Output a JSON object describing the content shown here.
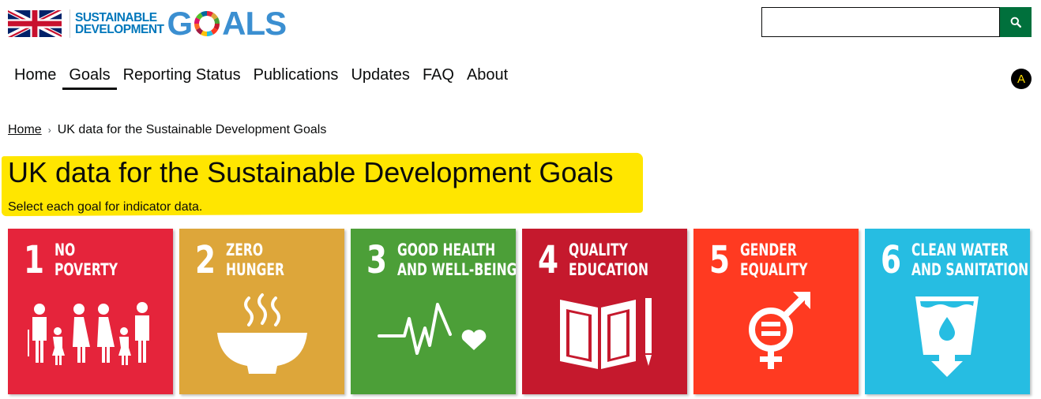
{
  "header": {
    "logo_line1": "SUSTAINABLE",
    "logo_line2": "DEVELOPMENT",
    "logo_big_pre": "G",
    "logo_big_post": "ALS",
    "search_placeholder": ""
  },
  "nav": {
    "items": [
      "Home",
      "Goals",
      "Reporting Status",
      "Publications",
      "Updates",
      "FAQ",
      "About"
    ],
    "active": "Goals",
    "accessibility_label": "A"
  },
  "breadcrumb": {
    "home": "Home",
    "separator": "›",
    "current": "UK data for the Sustainable Development Goals"
  },
  "page": {
    "title": "UK data for the Sustainable Development Goals",
    "subtitle": "Select each goal for indicator data."
  },
  "goals": [
    {
      "number": "1",
      "label": "NO\nPOVERTY",
      "color": "#e5243b",
      "icon": "family-icon"
    },
    {
      "number": "2",
      "label": "ZERO\nHUNGER",
      "color": "#dda63a",
      "icon": "bowl-icon"
    },
    {
      "number": "3",
      "label": "GOOD HEALTH\nAND WELL-BEING",
      "color": "#4c9f38",
      "icon": "heartbeat-icon"
    },
    {
      "number": "4",
      "label": "QUALITY\nEDUCATION",
      "color": "#c5192d",
      "icon": "book-pencil-icon"
    },
    {
      "number": "5",
      "label": "GENDER\nEQUALITY",
      "color": "#ff3a21",
      "icon": "gender-equality-icon"
    },
    {
      "number": "6",
      "label": "CLEAN WATER\nAND SANITATION",
      "color": "#26bde2",
      "icon": "water-glass-icon"
    }
  ],
  "colors": {
    "search_button": "#00703c",
    "highlight": "#ffe600",
    "accessibility_text": "#ffdd00"
  }
}
